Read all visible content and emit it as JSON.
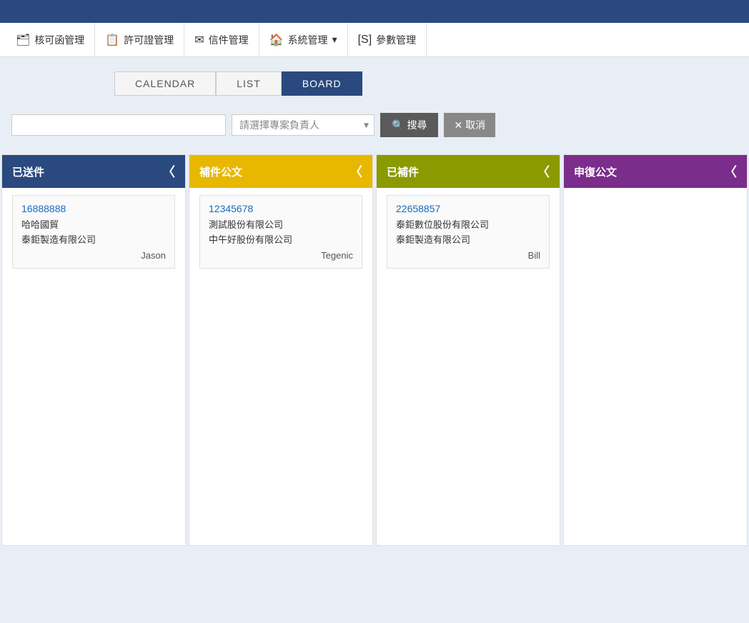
{
  "topBar": {},
  "nav": {
    "items": [
      {
        "id": "approval",
        "icon": "🗂",
        "label": "核可函管理"
      },
      {
        "id": "license",
        "icon": "📋",
        "label": "許可證管理"
      },
      {
        "id": "mail",
        "icon": "✉",
        "label": "信件管理"
      },
      {
        "id": "system",
        "icon": "🏠",
        "label": "系統管理",
        "hasDropdown": true
      },
      {
        "id": "params",
        "icon": "[S]",
        "label": "參數管理"
      }
    ]
  },
  "tabs": [
    {
      "id": "calendar",
      "label": "CALENDAR",
      "active": false
    },
    {
      "id": "list",
      "label": "LIST",
      "active": false
    },
    {
      "id": "board",
      "label": "BOARD",
      "active": true
    }
  ],
  "search": {
    "inputPlaceholder": "",
    "selectPlaceholder": "請選擇專案負責人",
    "searchBtn": "搜尋",
    "cancelBtn": "取消"
  },
  "columns": [
    {
      "id": "sent",
      "title": "已送件",
      "colorClass": "blue",
      "cards": [
        {
          "id": "16888888",
          "lines": [
            "哈哈國貿",
            "泰鉅製造有限公司"
          ],
          "assignee": "Jason"
        }
      ]
    },
    {
      "id": "supplement",
      "title": "補件公文",
      "colorClass": "yellow",
      "cards": [
        {
          "id": "12345678",
          "lines": [
            "測試股份有限公司",
            "中午好股份有限公司"
          ],
          "assignee": "Tegenic"
        }
      ]
    },
    {
      "id": "supplemented",
      "title": "已補件",
      "colorClass": "olive",
      "cards": [
        {
          "id": "22658857",
          "lines": [
            "泰鉅數位股份有限公司",
            "泰鉅製造有限公司"
          ],
          "assignee": "Bill"
        }
      ]
    },
    {
      "id": "appeal",
      "title": "申復公文",
      "colorClass": "purple",
      "cards": []
    }
  ]
}
